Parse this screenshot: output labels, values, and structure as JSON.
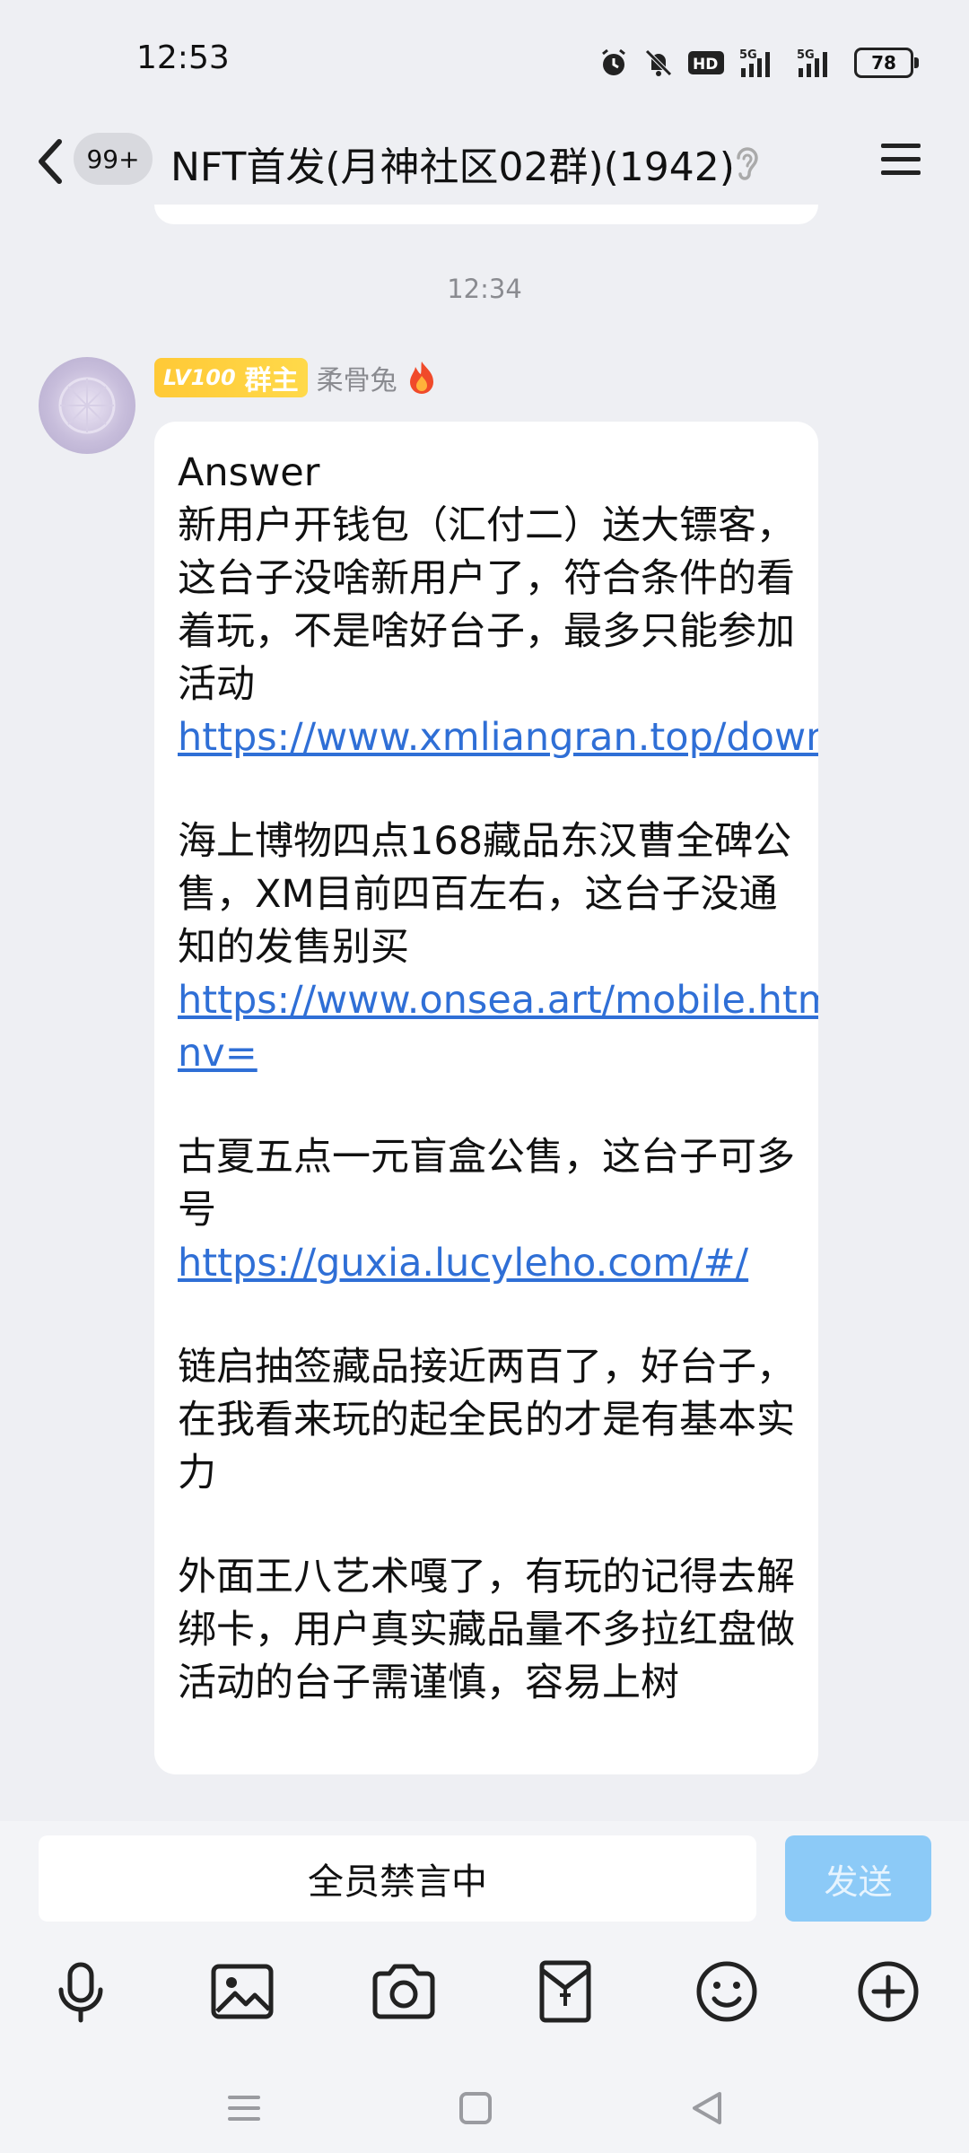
{
  "status_bar": {
    "time": "12:53",
    "battery": "78",
    "icons": [
      "alarm-icon",
      "mute-icon",
      "hd-icon",
      "signal-5g-icon",
      "signal-5g-2-icon",
      "battery-icon"
    ]
  },
  "header": {
    "unread_badge": "99+",
    "title": "NFT首发(月神社区02群)(1942)",
    "icons": [
      "back-icon",
      "ear-icon",
      "menu-icon"
    ]
  },
  "chat": {
    "timestamp": "12:34",
    "message": {
      "level": "LV100",
      "role": "群主",
      "sender": "柔骨兔",
      "lines": [
        "Answer",
        "新用户开钱包（汇付二）送大镖客，这台子没啥新用户了，符合条件的看着玩，不是啥好台子，最多只能参加活动",
        "https://www.xmliangran.top/download/index.html",
        "海上博物四点168藏品东汉曹全碑公售，XM目前四百左右，这台子没通知的发售别买",
        "https://www.onsea.art/mobile.html?nv=",
        "古夏五点一元盲盒公售，这台子可多号",
        "https://guxia.lucyleho.com/#/",
        "链启抽签藏品接近两百了，好台子，在我看来玩的起全民的才是有基本实力",
        "外面王八艺术嘎了，有玩的记得去解绑卡，用户真实藏品量不多拉红盘做活动的台子需谨慎，容易上树"
      ]
    }
  },
  "input_bar": {
    "mute_notice": "全员禁言中",
    "send_label": "发送",
    "tools": [
      "microphone-icon",
      "image-icon",
      "camera-icon",
      "red-packet-icon",
      "emoji-icon",
      "plus-icon"
    ]
  },
  "nav_bar": {
    "buttons": [
      "nav-menu-icon",
      "nav-home-icon",
      "nav-back-icon"
    ]
  },
  "colors": {
    "link": "#2f6fd6",
    "send_button": "#8ccaf7",
    "level_badge": "#ffc936",
    "background": "#eeeff3"
  }
}
